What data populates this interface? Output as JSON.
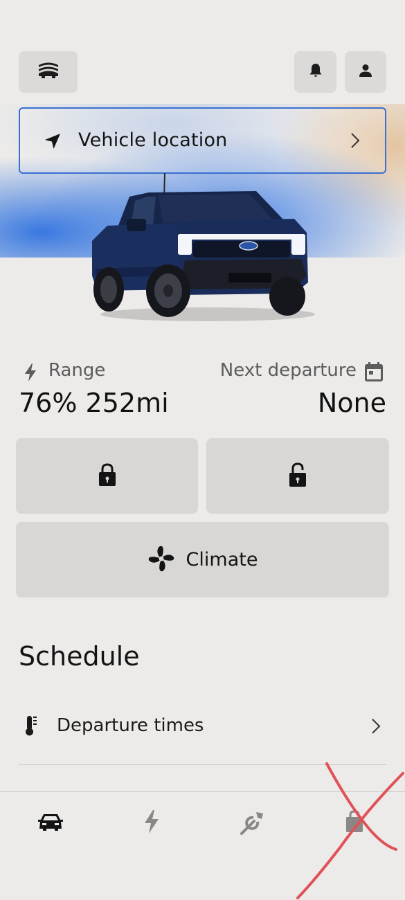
{
  "header": {
    "menu_icon": "vehicle-switcher-icon",
    "notifications_icon": "bell-icon",
    "profile_icon": "person-icon"
  },
  "location": {
    "label": "Vehicle location",
    "icon": "navigation-arrow-icon"
  },
  "stats": {
    "range": {
      "label": "Range",
      "value": "76% 252mi",
      "icon": "lightning-icon"
    },
    "departure": {
      "label": "Next departure",
      "value": "None",
      "icon": "calendar-icon"
    }
  },
  "actions": {
    "lock_icon": "lock-icon",
    "unlock_icon": "unlock-icon",
    "climate_label": "Climate",
    "climate_icon": "fan-icon"
  },
  "schedule": {
    "title": "Schedule",
    "items": [
      {
        "label": "Departure times",
        "icon": "thermometer-icon"
      }
    ]
  },
  "nav": {
    "items": [
      "car-icon",
      "charging-icon",
      "wrench-icon",
      "shopping-bag-icon"
    ]
  },
  "colors": {
    "background": "#edebe9",
    "tile": "#d9d7d5",
    "accent_border": "#3a6fd0",
    "hero_blue": "#2f72e0",
    "annotation_red": "#e0525a"
  }
}
